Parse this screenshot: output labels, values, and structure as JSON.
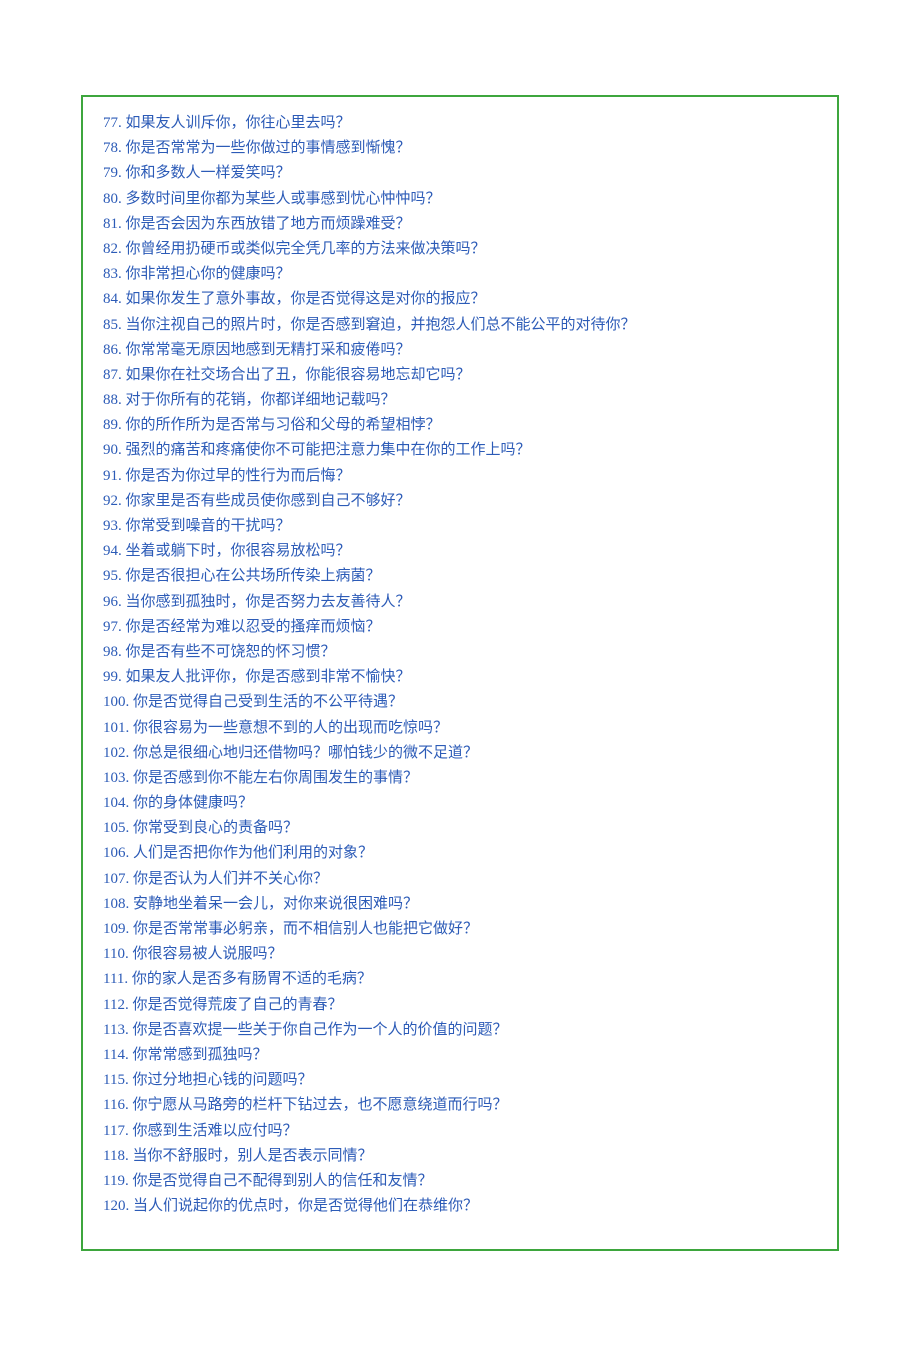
{
  "questions": [
    {
      "num": "77.",
      "text": "如果友人训斥你，你往心里去吗？"
    },
    {
      "num": "78.",
      "text": "你是否常常为一些你做过的事情感到惭愧？"
    },
    {
      "num": "79.",
      "text": "你和多数人一样爱笑吗？"
    },
    {
      "num": "80.",
      "text": "多数时间里你都为某些人或事感到忧心忡忡吗？"
    },
    {
      "num": "81.",
      "text": "你是否会因为东西放错了地方而烦躁难受？"
    },
    {
      "num": "82.",
      "text": "你曾经用扔硬币或类似完全凭几率的方法来做决策吗？"
    },
    {
      "num": "83.",
      "text": "你非常担心你的健康吗？"
    },
    {
      "num": "84.",
      "text": "如果你发生了意外事故，你是否觉得这是对你的报应？"
    },
    {
      "num": "85.",
      "text": "当你注视自己的照片时，你是否感到窘迫，并抱怨人们总不能公平的对待你？"
    },
    {
      "num": "86.",
      "text": "你常常毫无原因地感到无精打采和疲倦吗？"
    },
    {
      "num": "87.",
      "text": "如果你在社交场合出了丑，你能很容易地忘却它吗？"
    },
    {
      "num": "88.",
      "text": "对于你所有的花销，你都详细地记载吗？"
    },
    {
      "num": "89.",
      "text": "你的所作所为是否常与习俗和父母的希望相悖？"
    },
    {
      "num": "90.",
      "text": "强烈的痛苦和疼痛使你不可能把注意力集中在你的工作上吗？"
    },
    {
      "num": "91.",
      "text": "你是否为你过早的性行为而后悔？"
    },
    {
      "num": "92.",
      "text": "你家里是否有些成员使你感到自己不够好？"
    },
    {
      "num": "93.",
      "text": "你常受到噪音的干扰吗？"
    },
    {
      "num": "94.",
      "text": "坐着或躺下时，你很容易放松吗？"
    },
    {
      "num": "95.",
      "text": "你是否很担心在公共场所传染上病菌？"
    },
    {
      "num": "96.",
      "text": "当你感到孤独时，你是否努力去友善待人？"
    },
    {
      "num": "97.",
      "text": "你是否经常为难以忍受的搔痒而烦恼？"
    },
    {
      "num": "98.",
      "text": "你是否有些不可饶恕的怀习惯？"
    },
    {
      "num": "99.",
      "text": "如果友人批评你，你是否感到非常不愉快？"
    },
    {
      "num": "100.",
      "text": "你是否觉得自己受到生活的不公平待遇？"
    },
    {
      "num": "101.",
      "text": "你很容易为一些意想不到的人的出现而吃惊吗？"
    },
    {
      "num": "102.",
      "text": "你总是很细心地归还借物吗？哪怕钱少的微不足道？"
    },
    {
      "num": "103.",
      "text": "你是否感到你不能左右你周围发生的事情？"
    },
    {
      "num": "104.",
      "text": "你的身体健康吗？"
    },
    {
      "num": "105.",
      "text": "你常受到良心的责备吗？"
    },
    {
      "num": "106.",
      "text": "人们是否把你作为他们利用的对象？"
    },
    {
      "num": "107.",
      "text": "你是否认为人们并不关心你？"
    },
    {
      "num": "108.",
      "text": "安静地坐着呆一会儿，对你来说很困难吗？"
    },
    {
      "num": "109.",
      "text": "你是否常常事必躬亲，而不相信别人也能把它做好？"
    },
    {
      "num": "110.",
      "text": "你很容易被人说服吗？"
    },
    {
      "num": "111.",
      "text": "你的家人是否多有肠胃不适的毛病？"
    },
    {
      "num": "112.",
      "text": "你是否觉得荒废了自己的青春？"
    },
    {
      "num": "113.",
      "text": "你是否喜欢提一些关于你自己作为一个人的价值的问题？"
    },
    {
      "num": "114.",
      "text": "你常常感到孤独吗？"
    },
    {
      "num": "115.",
      "text": "你过分地担心钱的问题吗？"
    },
    {
      "num": "116.",
      "text": "你宁愿从马路旁的栏杆下钻过去，也不愿意绕道而行吗？"
    },
    {
      "num": "117.",
      "text": "你感到生活难以应付吗？"
    },
    {
      "num": "118.",
      "text": "当你不舒服时，别人是否表示同情？"
    },
    {
      "num": "119.",
      "text": "你是否觉得自己不配得到别人的信任和友情？"
    },
    {
      "num": "120.",
      "text": "当人们说起你的优点时，你是否觉得他们在恭维你？"
    }
  ]
}
